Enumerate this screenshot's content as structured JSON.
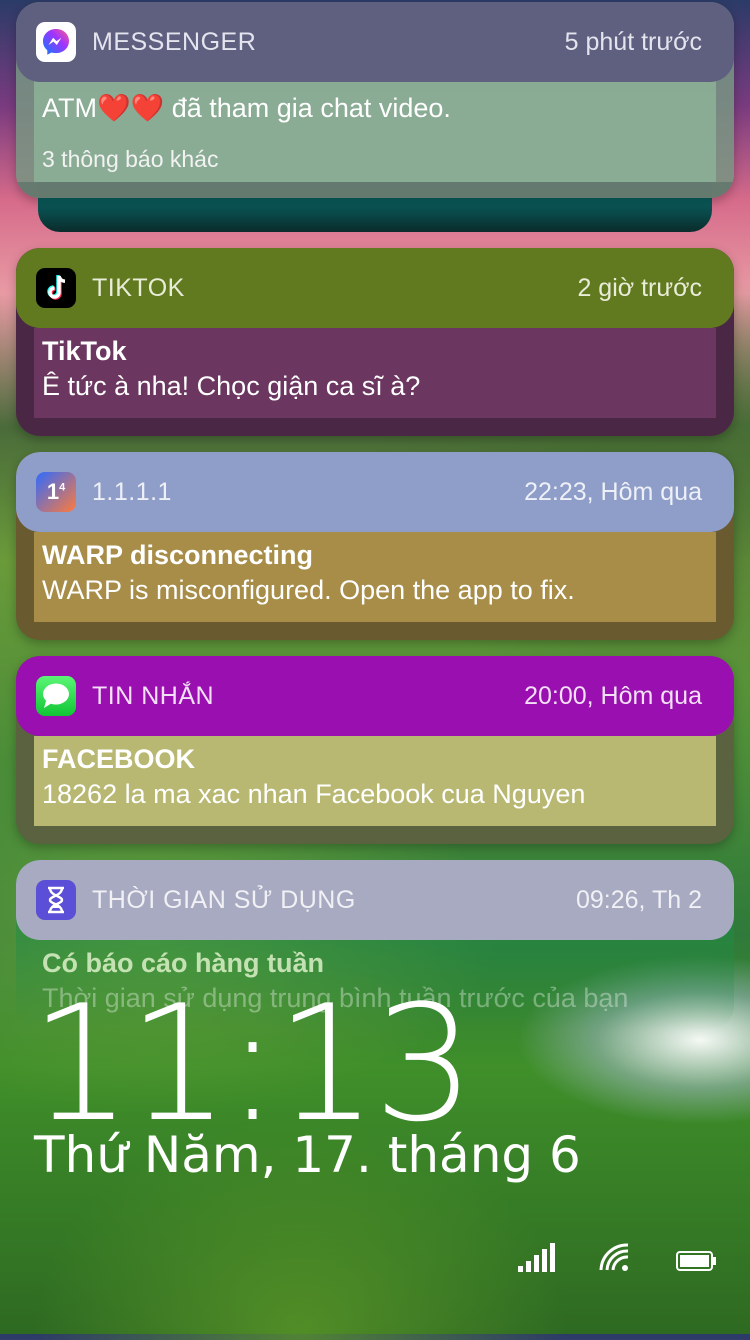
{
  "notifications": [
    {
      "app": "MESSENGER",
      "time": "5 phút trước",
      "message": "ATM❤️❤️ đã tham gia chat video.",
      "more": "3 thông báo khác",
      "icon": "messenger-icon"
    },
    {
      "app": "TIKTOK",
      "time": "2 giờ trước",
      "title": "TikTok",
      "message": "Ê tức à nha! Chọc giận ca sĩ à?",
      "icon": "tiktok-icon"
    },
    {
      "app": "1.1.1.1",
      "time": "22:23, Hôm qua",
      "title": "WARP disconnecting",
      "message": "WARP is misconfigured. Open the app to fix.",
      "icon": "cloudflare-1111-icon"
    },
    {
      "app": "TIN NHẮN",
      "time": "20:00, Hôm qua",
      "title": "FACEBOOK",
      "message": "18262 la ma xac nhan Facebook cua Nguyen",
      "icon": "messages-icon"
    },
    {
      "app": "THỜI GIAN SỬ DỤNG",
      "time": "09:26, Th 2",
      "title": "Có báo cáo hàng tuần",
      "message": "Thời gian sử dụng trung bình tuần trước của bạn",
      "icon": "hourglass-icon"
    }
  ],
  "lockscreen": {
    "clock": "11:13",
    "date": "Thứ Năm, 17. tháng 6"
  },
  "status": {
    "signal": "signal-bars-icon",
    "wifi": "wifi-icon",
    "battery": "battery-icon"
  }
}
